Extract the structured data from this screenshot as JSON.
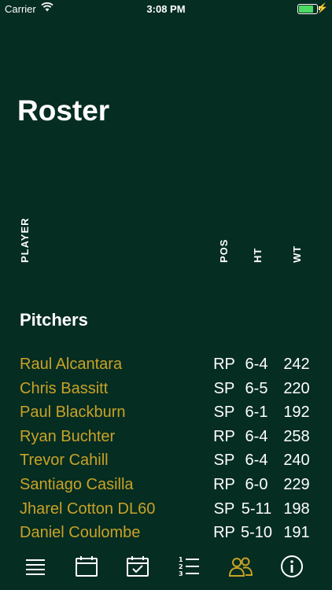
{
  "status": {
    "carrier": "Carrier",
    "time": "3:08 PM",
    "battery_level": 0.9
  },
  "title": "Roster",
  "columns": {
    "player": "PLAYER",
    "pos": "POS",
    "ht": "HT",
    "wt": "WT"
  },
  "section": "Pitchers",
  "players": [
    {
      "name": "Raul Alcantara",
      "pos": "RP",
      "ht": "6-4",
      "wt": "242"
    },
    {
      "name": "Chris Bassitt",
      "pos": "SP",
      "ht": "6-5",
      "wt": "220"
    },
    {
      "name": "Paul Blackburn",
      "pos": "SP",
      "ht": "6-1",
      "wt": "192"
    },
    {
      "name": "Ryan Buchter",
      "pos": "RP",
      "ht": "6-4",
      "wt": "258"
    },
    {
      "name": "Trevor Cahill",
      "pos": "SP",
      "ht": "6-4",
      "wt": "240"
    },
    {
      "name": "Santiago Casilla",
      "pos": "RP",
      "ht": "6-0",
      "wt": "229"
    },
    {
      "name": "Jharel Cotton DL60",
      "pos": "SP",
      "ht": "5-11",
      "wt": "198"
    },
    {
      "name": "Daniel Coulombe",
      "pos": "RP",
      "ht": "5-10",
      "wt": "191"
    }
  ],
  "tabs": [
    {
      "icon": "menu-icon",
      "active": false
    },
    {
      "icon": "calendar-icon",
      "active": false
    },
    {
      "icon": "calendar-check-icon",
      "active": false
    },
    {
      "icon": "numbered-list-icon",
      "active": false
    },
    {
      "icon": "people-icon",
      "active": true
    },
    {
      "icon": "info-icon",
      "active": false
    }
  ],
  "colors": {
    "background": "#062d22",
    "accent": "#c9a227",
    "text": "#ffffff"
  }
}
